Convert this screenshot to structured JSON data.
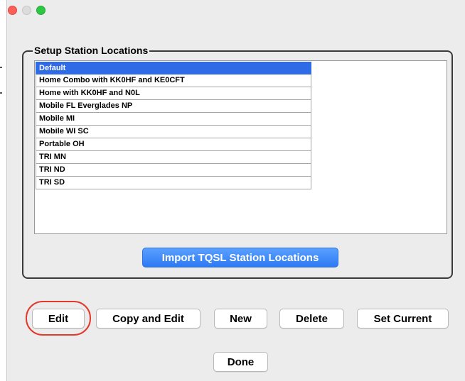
{
  "dialog": {
    "group_title": "Setup Station Locations",
    "locations": [
      {
        "label": "Default",
        "selected": true
      },
      {
        "label": "Home Combo with KK0HF and KE0CFT",
        "selected": false
      },
      {
        "label": "Home with KK0HF and N0L",
        "selected": false
      },
      {
        "label": "Mobile FL Everglades NP",
        "selected": false
      },
      {
        "label": "Mobile MI",
        "selected": false
      },
      {
        "label": "Mobile WI SC",
        "selected": false
      },
      {
        "label": "Portable OH",
        "selected": false
      },
      {
        "label": "TRI MN",
        "selected": false
      },
      {
        "label": "TRI ND",
        "selected": false
      },
      {
        "label": "TRI SD",
        "selected": false
      }
    ],
    "import_label": "Import TQSL Station Locations",
    "buttons": {
      "edit": "Edit",
      "copy_edit": "Copy and Edit",
      "new": "New",
      "delete": "Delete",
      "set_current": "Set Current",
      "done": "Done"
    }
  },
  "colors": {
    "selection": "#2f6be6",
    "accent_button": "#2d7af3",
    "highlight_ring": "#e2392c"
  }
}
